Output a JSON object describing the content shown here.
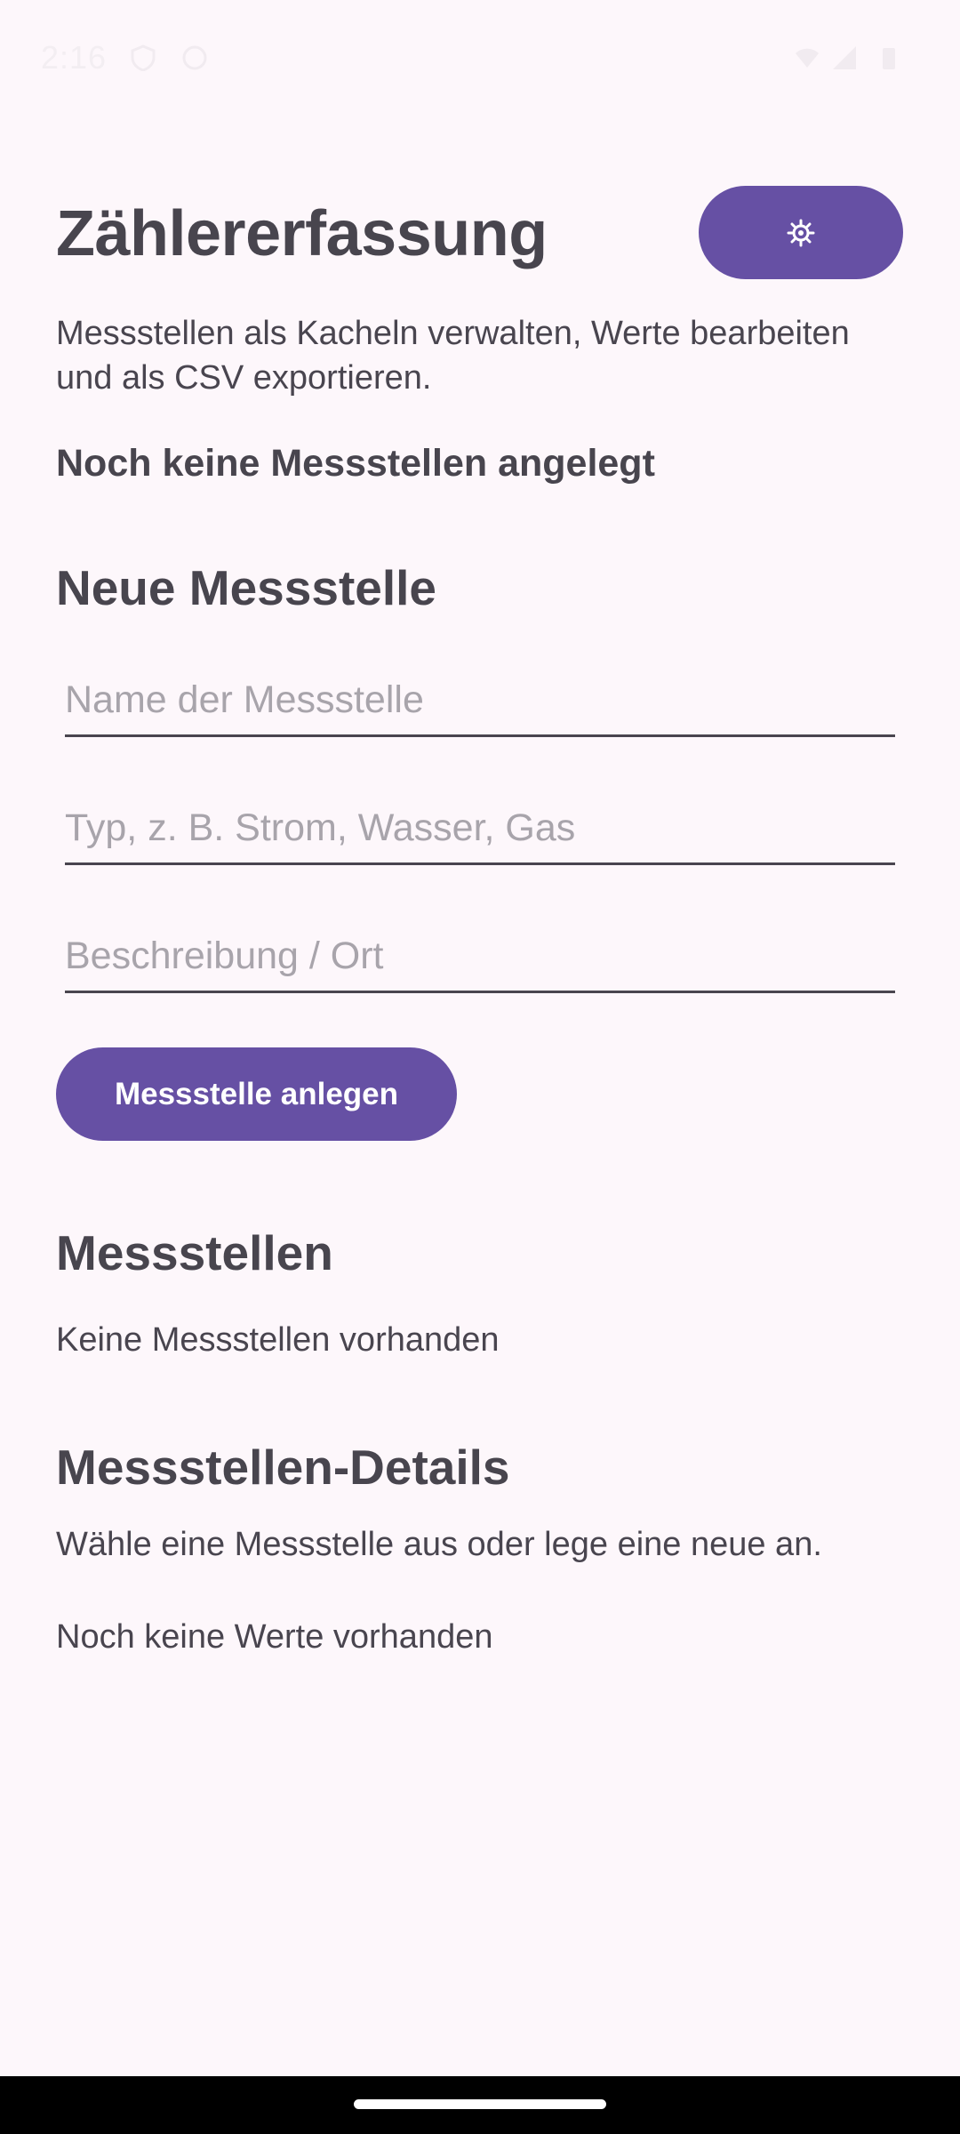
{
  "status_bar": {
    "time": "2:16",
    "icons": [
      "shield-icon",
      "face-icon",
      "wifi-icon",
      "signal-icon",
      "battery-icon"
    ]
  },
  "header": {
    "title": "Zählererfassung",
    "settings_icon": "gear-icon",
    "subtitle": "Messstellen als Kacheln verwalten, Werte bearbeiten und als CSV exportieren."
  },
  "empty_banner": "Noch keine Messstellen angelegt",
  "new_section": {
    "heading": "Neue Messstelle",
    "name_placeholder": "Name der Messstelle",
    "type_placeholder": "Typ, z. B. Strom, Wasser, Gas",
    "description_placeholder": "Beschreibung / Ort",
    "create_button_label": "Messstelle anlegen"
  },
  "list_section": {
    "heading": "Messstellen",
    "empty_text": "Keine Messstellen vorhanden"
  },
  "details_section": {
    "heading": "Messstellen-Details",
    "hint": "Wähle eine Messstelle aus oder lege eine neue an.",
    "no_values": "Noch keine Werte vorhanden"
  },
  "colors": {
    "background": "#fdf7fb",
    "primary": "#6650a4",
    "text": "#49454f"
  }
}
